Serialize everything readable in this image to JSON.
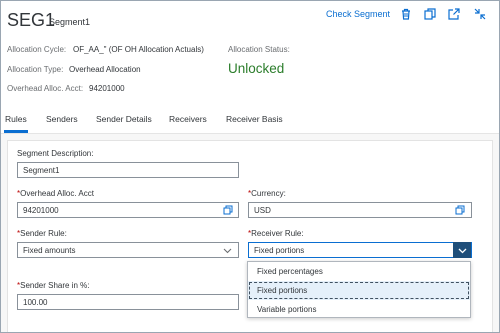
{
  "header": {
    "title": "SEG1",
    "subtitle": "Segment1",
    "actions": {
      "check_segment": "Check Segment"
    },
    "icons": [
      "delete-icon",
      "copy-icon",
      "share-icon",
      "exit-fullscreen-icon"
    ]
  },
  "attributes": {
    "allocation_cycle_label": "Allocation Cycle:",
    "allocation_cycle_value": "OF_AA_\" (OF OH Allocation Actuals)",
    "allocation_type_label": "Allocation Type:",
    "allocation_type_value": "Overhead Allocation",
    "overhead_acct_label": "Overhead Alloc. Acct:",
    "overhead_acct_value": "94201000",
    "status_label": "Allocation Status:",
    "status_value": "Unlocked",
    "status_color": "#2b7d2b"
  },
  "tabs": [
    {
      "label": "Rules",
      "active": true
    },
    {
      "label": "Senders"
    },
    {
      "label": "Sender Details"
    },
    {
      "label": "Receivers"
    },
    {
      "label": "Receiver Basis"
    }
  ],
  "form": {
    "segment_description": {
      "label": "Segment Description:",
      "value": "Segment1"
    },
    "overhead_acct": {
      "required": "*",
      "label": "Overhead Alloc. Acct",
      "value": "94201000"
    },
    "currency": {
      "required": "*",
      "label": "Currency:",
      "value": "USD"
    },
    "sender_rule": {
      "required": "*",
      "label": "Sender Rule:",
      "value": "Fixed amounts"
    },
    "receiver_rule": {
      "required": "*",
      "label": "Receiver Rule:",
      "value": "Fixed portions",
      "options": [
        "Fixed percentages",
        "Fixed portions",
        "Variable portions"
      ],
      "selected": "Fixed portions"
    },
    "sender_share": {
      "required": "*",
      "label": "Sender Share in %:",
      "value": "100.00"
    }
  },
  "colors": {
    "accent": "#0a6ed1",
    "dropdown_button": "#1f4f7a",
    "required": "#bb0000"
  }
}
